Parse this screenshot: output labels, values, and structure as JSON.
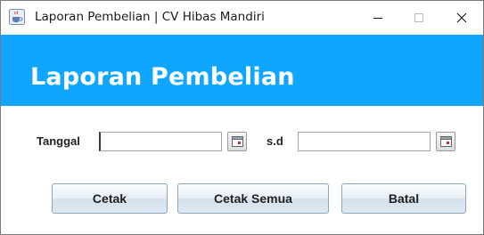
{
  "window": {
    "title": "Laporan Pembelian | CV Hibas Mandiri",
    "app_icon": "java-cup-icon",
    "controls": [
      "minimize-icon",
      "maximize-icon",
      "close-icon"
    ]
  },
  "header": {
    "title": "Laporan Pembelian",
    "background_color": "#10a6ff",
    "text_color": "#ffffff"
  },
  "filter": {
    "from_label": "Tanggal",
    "from_value": "",
    "to_label": "s.d",
    "to_value": "",
    "calendar_icon": "calendar-icon"
  },
  "actions": {
    "print_label": "Cetak",
    "print_all_label": "Cetak Semua",
    "cancel_label": "Batal"
  }
}
